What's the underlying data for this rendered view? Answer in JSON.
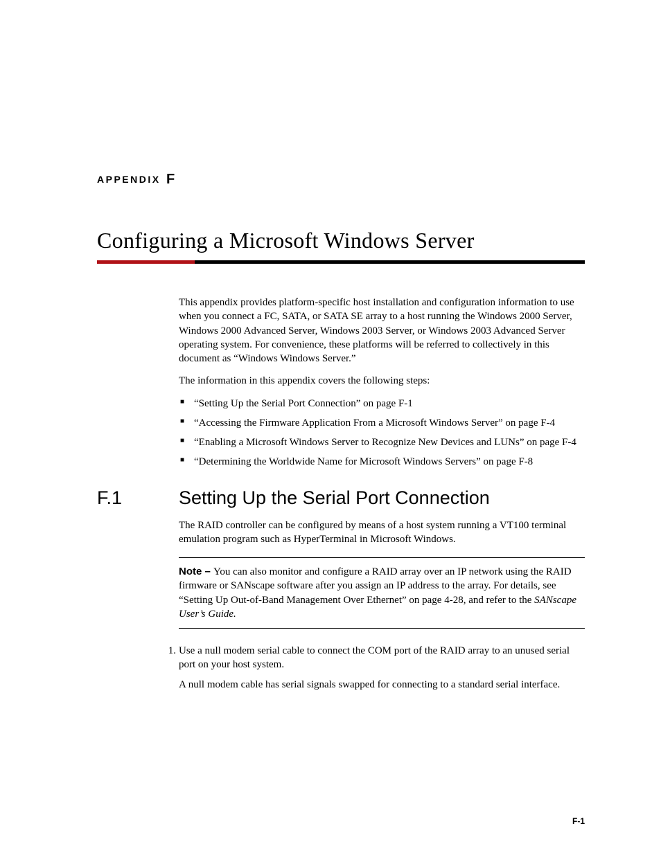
{
  "appendix_label_prefix": "APPENDIX",
  "appendix_letter": "F",
  "title": "Configuring a Microsoft Windows Server",
  "intro_para": "This appendix provides platform-specific host installation and configuration information to use when you connect a FC, SATA, or SATA SE array to a host running the Windows 2000 Server, Windows 2000 Advanced Server, Windows 2003 Server, or Windows 2003 Advanced Server operating system. For convenience, these platforms will be referred to collectively in this document as “Windows Windows Server.”",
  "coverage_intro": "The information in this appendix covers the following steps:",
  "bullets": [
    "“Setting Up the Serial Port Connection” on page F-1",
    "“Accessing the Firmware Application From a Microsoft Windows Server” on page F-4",
    "“Enabling a Microsoft Windows Server to Recognize New Devices and LUNs” on page F-4",
    "“Determining the Worldwide Name for Microsoft Windows Servers” on page F-8"
  ],
  "section_number": "F.1",
  "section_title": "Setting Up the Serial Port Connection",
  "section_para": "The RAID controller can be configured by means of a host system running a VT100 terminal emulation program such as HyperTerminal in Microsoft Windows.",
  "note": {
    "label": "Note – ",
    "body": "You can also monitor and configure a RAID array over an IP network using the RAID firmware or SANscape software after you assign an IP address to the array. For details, see “Setting Up Out-of-Band Management Over Ethernet” on page 4-28, and refer to the ",
    "italic_tail": "SANscape User’s Guide."
  },
  "step1": {
    "number": "1.",
    "text": "Use a null modem serial cable to connect the COM port of the RAID array to an unused serial port on your host system.",
    "subtext": "A null modem cable has serial signals swapped for connecting to a standard serial interface."
  },
  "page_number": "F-1"
}
